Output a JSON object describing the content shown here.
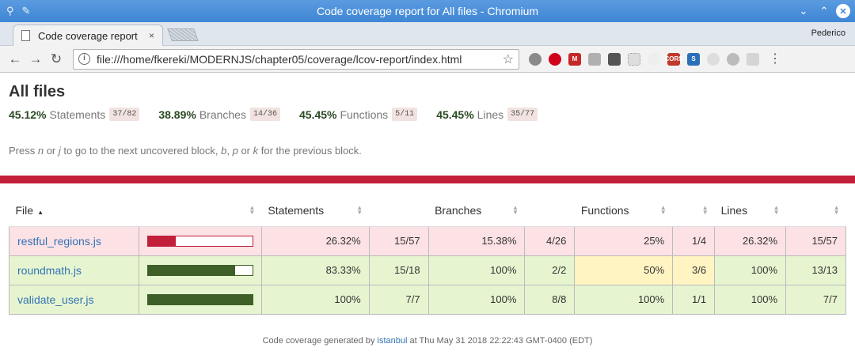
{
  "window": {
    "title": "Code coverage report for All files - Chromium",
    "controls": [
      "minimize-icon",
      "maximize-icon",
      "close-icon"
    ]
  },
  "tab": {
    "title": "Code coverage report",
    "close": "×"
  },
  "profile": "Pederico",
  "toolbar": {
    "url": "file:///home/fkereki/MODERNJS/chapter05/coverage/lcov-report/index.html"
  },
  "page": {
    "heading": "All files",
    "summary": [
      {
        "pct": "45.12%",
        "label": "Statements",
        "frac": "37/82"
      },
      {
        "pct": "38.89%",
        "label": "Branches",
        "frac": "14/36"
      },
      {
        "pct": "45.45%",
        "label": "Functions",
        "frac": "5/11"
      },
      {
        "pct": "45.45%",
        "label": "Lines",
        "frac": "35/77"
      }
    ],
    "help": {
      "t1": "Press ",
      "k1": "n",
      "t2": " or ",
      "k2": "j",
      "t3": " to go to the next uncovered block, ",
      "k3": "b",
      "t4": ", ",
      "k4": "p",
      "t5": " or ",
      "k5": "k",
      "t6": " for the previous block."
    },
    "status_color": "#c21f39"
  },
  "table": {
    "headers": {
      "file": "File",
      "statements": "Statements",
      "branches": "Branches",
      "functions": "Functions",
      "lines": "Lines"
    },
    "rows": [
      {
        "file": "restful_regions.js",
        "coverage": 0.2632,
        "bar_color": "#c21f39",
        "class": "low",
        "stmt_pct": "26.32%",
        "stmt_frac": "15/57",
        "br_pct": "15.38%",
        "br_frac": "4/26",
        "fn_pct": "25%",
        "fn_frac": "1/4",
        "ln_pct": "26.32%",
        "ln_frac": "15/57"
      },
      {
        "file": "roundmath.js",
        "coverage": 0.8333,
        "bar_color": "#3f5f28",
        "class": "high",
        "stmt_pct": "83.33%",
        "stmt_frac": "15/18",
        "br_pct": "100%",
        "br_frac": "2/2",
        "fn_pct": "50%",
        "fn_frac": "3/6",
        "ln_pct": "100%",
        "ln_frac": "13/13"
      },
      {
        "file": "validate_user.js",
        "coverage": 1.0,
        "bar_color": "#3f5f28",
        "class": "high",
        "stmt_pct": "100%",
        "stmt_frac": "7/7",
        "br_pct": "100%",
        "br_frac": "8/8",
        "fn_pct": "100%",
        "fn_frac": "1/1",
        "ln_pct": "100%",
        "ln_frac": "7/7"
      }
    ]
  },
  "footer": {
    "prefix": "Code coverage generated by ",
    "link": "istanbul",
    "suffix": " at Thu May 31 2018 22:22:43 GMT-0400 (EDT)"
  }
}
